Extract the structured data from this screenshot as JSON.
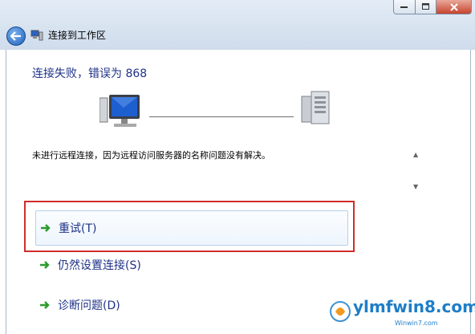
{
  "nav": {
    "title": "连接到工作区"
  },
  "status": {
    "heading": "连接失败，错误为 868"
  },
  "message": {
    "text": "未进行远程连接，因为远程访问服务器的名称问题没有解决。"
  },
  "options": [
    {
      "label": "重试(T)"
    },
    {
      "label": "仍然设置连接(S)"
    },
    {
      "label": "诊断问题(D)"
    }
  ],
  "watermark": {
    "text": "ylmfwin8.com",
    "sub": "Winwin7.com"
  },
  "colors": {
    "link": "#1e3287",
    "highlight": "#d12c2c",
    "arrow": "#2d9a2d"
  },
  "icons": [
    "back-arrow-icon",
    "network-icon",
    "computer-icon",
    "server-icon",
    "green-arrow-icon"
  ]
}
